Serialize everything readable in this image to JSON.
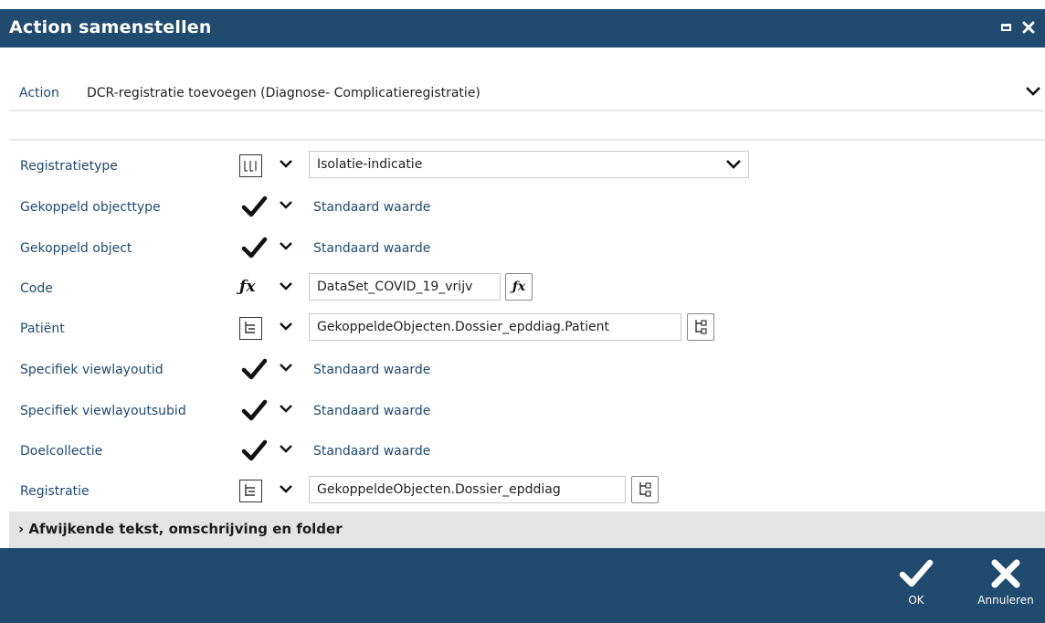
{
  "window": {
    "title": "Action samenstellen",
    "maximize_icon": "maximize-icon",
    "close_icon": "close-icon"
  },
  "action": {
    "label": "Action",
    "value": "DCR-registratie toevoegen (Diagnose- Complicatieregistratie)"
  },
  "params": [
    {
      "label": "Registratietype",
      "mode_icon": "list-value-icon",
      "kind": "dropdown",
      "value": "Isolatie-indicatie"
    },
    {
      "label": "Gekoppeld objecttype",
      "mode_icon": "checkmark-icon",
      "kind": "default",
      "value": "Standaard waarde"
    },
    {
      "label": "Gekoppeld object",
      "mode_icon": "checkmark-icon",
      "kind": "default",
      "value": "Standaard waarde"
    },
    {
      "label": "Code",
      "mode_icon": "fx-icon",
      "kind": "expression",
      "value": "DataSet_COVID_19_vrijv"
    },
    {
      "label": "Patiënt",
      "mode_icon": "tree-icon",
      "kind": "tree",
      "value": "GekoppeldeObjecten.Dossier_epddiag.Patient"
    },
    {
      "label": "Specifiek viewlayoutid",
      "mode_icon": "checkmark-icon",
      "kind": "default",
      "value": "Standaard waarde"
    },
    {
      "label": "Specifiek viewlayoutsubid",
      "mode_icon": "checkmark-icon",
      "kind": "default",
      "value": "Standaard waarde"
    },
    {
      "label": "Doelcollectie",
      "mode_icon": "checkmark-icon",
      "kind": "default",
      "value": "Standaard waarde"
    },
    {
      "label": "Registratie",
      "mode_icon": "tree-icon",
      "kind": "tree",
      "value": "GekoppeldeObjecten.Dossier_epddiag"
    }
  ],
  "section": {
    "label": "Afwijkende tekst, omschrijving en folder"
  },
  "buttons": {
    "ok": "OK",
    "cancel": "Annuleren"
  },
  "colors": {
    "header_bg": "#204a6e",
    "label_text": "#1f4a70",
    "section_bg": "#e4e4e4"
  }
}
